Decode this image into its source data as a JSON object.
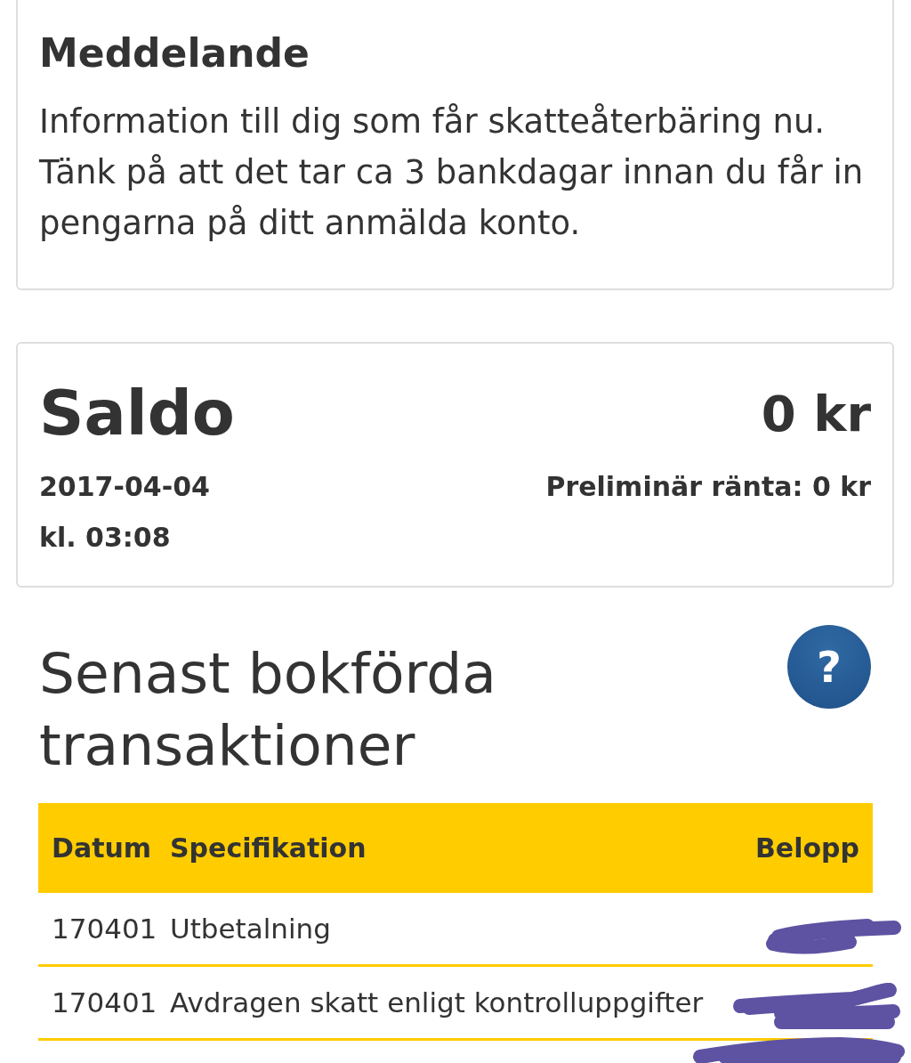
{
  "message": {
    "title": "Meddelande",
    "text": "Information till dig som får skatteåterbäring nu. Tänk på att det tar ca 3 bankdagar innan du får in pengarna på ditt anmälda konto."
  },
  "balance": {
    "title": "Saldo",
    "amount": "0 kr",
    "date": "2017-04-04",
    "time": "kl. 03:08",
    "interest": "Preliminär ränta: 0 kr"
  },
  "transactions": {
    "title": "Senast bokförda transaktioner",
    "help_button": {
      "label": "?"
    },
    "columns": [
      "Datum",
      "Specifikation",
      "Belopp"
    ],
    "rows": [
      {
        "date": "170401",
        "specification": "Utbetalning",
        "redacted": true
      },
      {
        "date": "170401",
        "specification": "Avdragen skatt enligt kontrolluppgifter",
        "redacted": true
      },
      {
        "redacted": true
      }
    ]
  }
}
